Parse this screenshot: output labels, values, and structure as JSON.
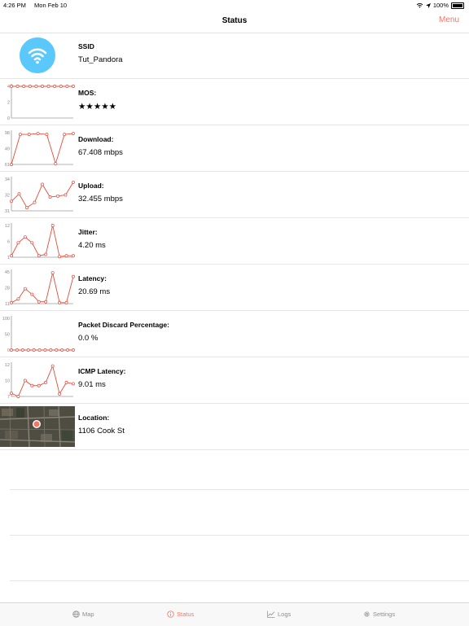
{
  "status_bar": {
    "time": "4:26 PM",
    "date": "Mon Feb 10",
    "battery": "100%"
  },
  "nav": {
    "title": "Status",
    "menu": "Menu"
  },
  "rows": [
    {
      "title": "SSID",
      "value": "Tut_Pandora"
    },
    {
      "title": "MOS:",
      "value": "★★★★★",
      "chart": {
        "type": "line",
        "yticks": [
          "4",
          "2",
          "0"
        ],
        "ylim": [
          0,
          4
        ],
        "values": [
          4,
          4,
          4,
          4,
          4,
          4,
          4,
          4,
          4,
          4,
          4
        ]
      }
    },
    {
      "title": "Download:",
      "value": "67.408 mbps",
      "chart": {
        "type": "line",
        "yticks": [
          "98",
          "49",
          "61"
        ],
        "ylim": [
          61,
          98
        ],
        "values": [
          61,
          96,
          96,
          97,
          96,
          62,
          96,
          97
        ]
      }
    },
    {
      "title": "Upload:",
      "value": "32.455 mbps",
      "chart": {
        "type": "line",
        "yticks": [
          "34",
          "32",
          "31"
        ],
        "ylim": [
          31,
          34
        ],
        "values": [
          31.9,
          32.6,
          31.3,
          31.8,
          33.5,
          32.3,
          32.4,
          32.5,
          33.7
        ]
      }
    },
    {
      "title": "Jitter:",
      "value": "4.20 ms",
      "chart": {
        "type": "line",
        "yticks": [
          "12",
          "6",
          "1"
        ],
        "ylim": [
          1,
          12
        ],
        "values": [
          1.5,
          6,
          8,
          6,
          1.5,
          2,
          12,
          1.2,
          1.5,
          1.5
        ]
      }
    },
    {
      "title": "Latency:",
      "value": "20.69 ms",
      "chart": {
        "type": "line",
        "yticks": [
          "45",
          "28",
          "11"
        ],
        "ylim": [
          11,
          45
        ],
        "values": [
          12,
          16,
          27,
          21,
          13,
          13,
          44,
          12,
          12,
          40
        ]
      }
    },
    {
      "title": "Packet Discard Percentage:",
      "value": "0.0 %",
      "chart": {
        "type": "line",
        "yticks": [
          "100",
          "50",
          "0"
        ],
        "ylim": [
          0,
          100
        ],
        "values": [
          0,
          0,
          0,
          0,
          0,
          0,
          0,
          0,
          0,
          0,
          0,
          0
        ]
      }
    },
    {
      "title": "ICMP Latency:",
      "value": "9.01 ms",
      "chart": {
        "type": "line",
        "yticks": [
          "12",
          "10",
          "7"
        ],
        "ylim": [
          7,
          12
        ],
        "values": [
          7.5,
          7,
          9.5,
          8.7,
          8.7,
          9.2,
          11.8,
          7.4,
          9.2,
          9
        ]
      }
    },
    {
      "title": "Location:",
      "value": "1106 Cook St"
    }
  ],
  "tabs": [
    {
      "label": "Map",
      "icon": "globe-icon"
    },
    {
      "label": "Status",
      "icon": "info-icon",
      "active": true
    },
    {
      "label": "Logs",
      "icon": "chart-icon"
    },
    {
      "label": "Settings",
      "icon": "gear-icon"
    }
  ],
  "colors": {
    "accent": "#f2776a",
    "line": "#e8483a",
    "wifi": "#5ac8fa"
  }
}
